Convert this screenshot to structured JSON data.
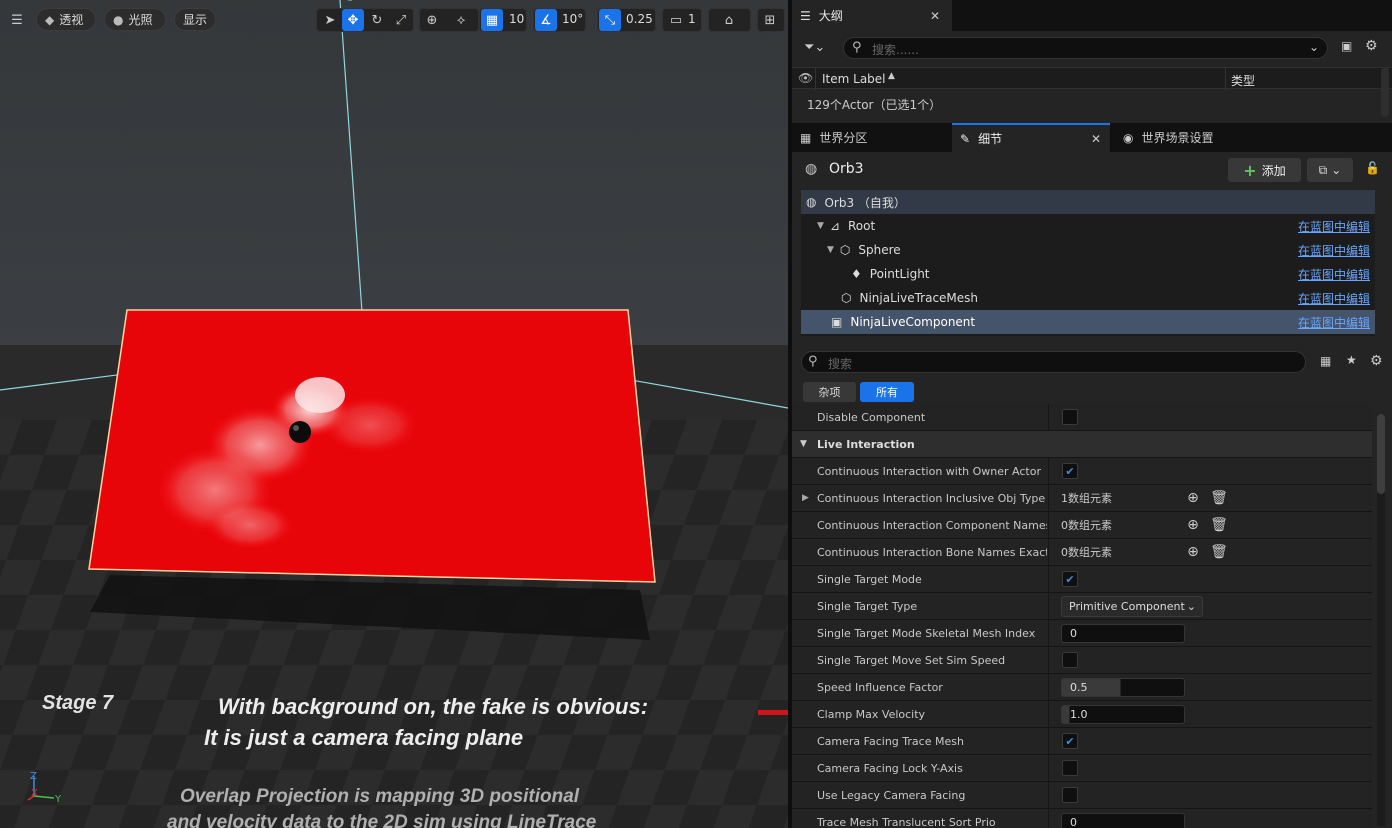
{
  "viewport": {
    "menu_icon": "hamburger-icon",
    "perspective_label": "透视",
    "lighting_label": "光照",
    "show_label": "显示",
    "grid_snap_value": "10",
    "rotation_snap_value": "10°",
    "scale_snap_value": "0.25",
    "camera_speed_value": "1",
    "overlay": {
      "stage": "Stage 7",
      "line1": "With background on, the fake is obvious:",
      "line2": "It is just a camera facing plane",
      "line3": "Overlap Projection is mapping 3D positional",
      "line4": "and velocity data to the 2D sim using LineTrace"
    },
    "axis_x": "X",
    "axis_y": "Y",
    "axis_z": "Z"
  },
  "outliner": {
    "tab_title": "大纲",
    "search_placeholder": "搜索......",
    "col_label": "Item Label",
    "col_type": "类型",
    "actor_count": "129个Actor（已选1个）"
  },
  "details_tabs": {
    "world_partition": "世界分区",
    "details": "细节",
    "world_settings": "世界场景设置"
  },
  "details": {
    "actor_name": "Orb3",
    "add_label": "添加",
    "edit_in_bp": "在蓝图中编辑",
    "tree": [
      {
        "label": "Orb3 （自我）"
      },
      {
        "label": "Root"
      },
      {
        "label": "Sphere"
      },
      {
        "label": "PointLight"
      },
      {
        "label": "NinjaLiveTraceMesh"
      },
      {
        "label": "NinjaLiveComponent"
      }
    ],
    "search_placeholder": "搜索",
    "filter_misc": "杂项",
    "filter_all": "所有",
    "properties": {
      "disable_component": "Disable Component",
      "section_live_interaction": "Live Interaction",
      "cont_owner": "Continuous Interaction with Owner Actor",
      "cont_inclusive": "Continuous Interaction Inclusive Obj Type",
      "cont_inclusive_value": "1数组元素",
      "cont_comp_names": "Continuous Interaction Component Names E...",
      "cont_comp_names_value": "0数组元素",
      "cont_bone_names": "Continuous Interaction Bone Names Exact",
      "cont_bone_names_value": "0数组元素",
      "single_target_mode": "Single Target Mode",
      "single_target_type": "Single Target Type",
      "single_target_type_value": "Primitive Component",
      "skel_mesh_index": "Single Target Mode Skeletal Mesh Index",
      "skel_mesh_index_value": "0",
      "move_sim_speed": "Single Target Move Set Sim Speed",
      "speed_influence": "Speed Influence Factor",
      "speed_influence_value": "0.5",
      "clamp_max_velocity": "Clamp Max Velocity",
      "clamp_max_velocity_value": "1.0",
      "cam_facing_trace": "Camera Facing Trace Mesh",
      "cam_facing_lock": "Camera Facing Lock Y-Axis",
      "legacy_cam_facing": "Use Legacy Camera Facing",
      "trace_sort_prio": "Trace Mesh Translucent Sort Prio",
      "trace_sort_prio_value": "0"
    }
  }
}
